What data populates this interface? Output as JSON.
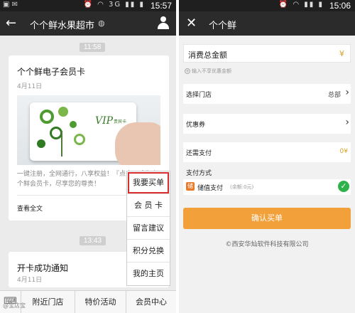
{
  "left": {
    "status_time": "15:57",
    "status_net": "3G",
    "title": "个个鲜水果超市",
    "timestamps": [
      "11:58",
      "13:43"
    ],
    "card1": {
      "title": "个个鲜电子会员卡",
      "date": "4月11日",
      "vip_text": "VIP",
      "vip_sub": "贵宾卡",
      "desc": "一键注册，全网通行，八享权益！『点击』成为个个鲜会员卡，尽享您的尊贵！",
      "more": "查看全文"
    },
    "card2": {
      "title": "开卡成功通知",
      "date": "4月11日"
    },
    "popup": [
      "我要买单",
      "会 员 卡",
      "留言建议",
      "积分兑换",
      "我的主页"
    ],
    "bottom": [
      "附近门店",
      "特价活动",
      "会员中心"
    ],
    "watermark": "@宝店宝"
  },
  "right": {
    "status_time": "15:06",
    "title": "个个鲜",
    "amount_label": "消费总金额",
    "amount_symbol": "¥",
    "hint": "输入不享优惠金额",
    "store_label": "选择门店",
    "store_value": "总部",
    "coupon_label": "优惠券",
    "due_label": "还需支付",
    "due_value": "0¥",
    "pay_method_label": "支付方式",
    "pay_option": "储值支付",
    "pay_balance": "(余额:0元)",
    "confirm": "确认买单",
    "copyright": "©西安华灿软件科技有限公司"
  },
  "colors": {
    "accent": "#f2a03a",
    "highlight": "#d92c2c",
    "check": "#2fb24b",
    "navbar": "#2b2b2b"
  },
  "icons": [
    "back-arrow-icon",
    "person-icon",
    "close-icon",
    "chevron-right-icon",
    "check-icon",
    "wallet-icon",
    "keyboard-icon"
  ]
}
